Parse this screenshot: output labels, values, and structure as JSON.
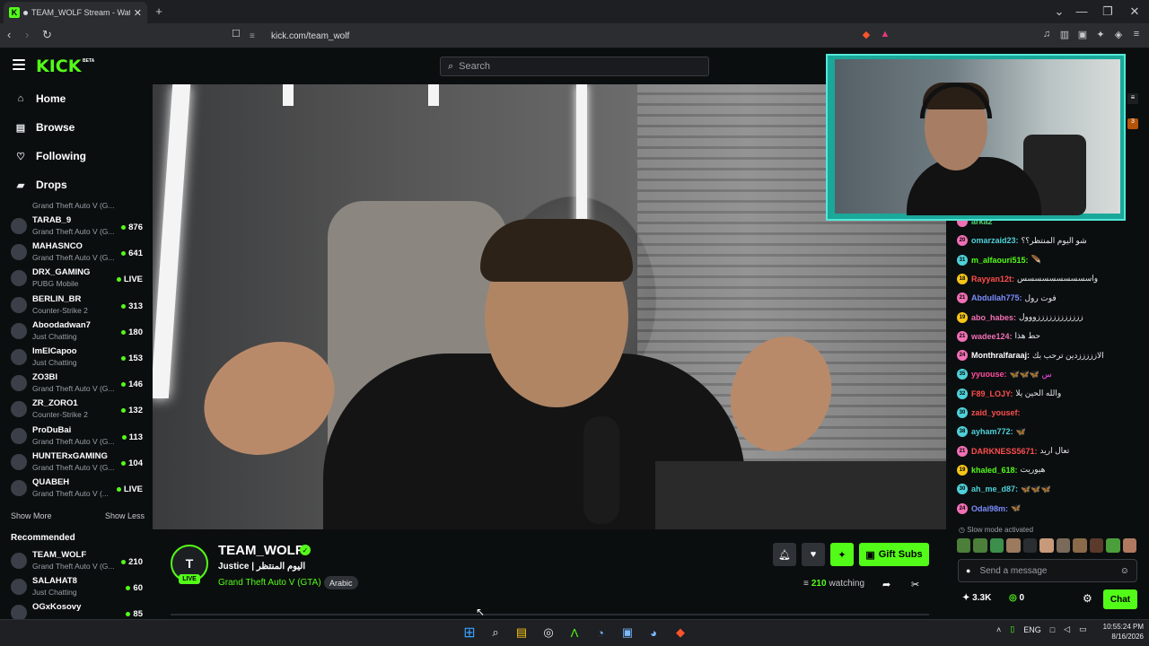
{
  "browser": {
    "tab_title": "TEAM_WOLF Stream - Watch",
    "tab_close": "✕",
    "new_tab": "+",
    "url": "kick.com/team_wolf",
    "window_controls": [
      "⌄",
      "—",
      "❐",
      "✕"
    ]
  },
  "header": {
    "logo": "KICK",
    "beta": "BETA",
    "search_placeholder": "Search"
  },
  "sidebar": {
    "nav": [
      {
        "label": "Home",
        "icon": "home-icon"
      },
      {
        "label": "Browse",
        "icon": "browse-icon"
      },
      {
        "label": "Following",
        "icon": "heart-icon"
      },
      {
        "label": "Drops",
        "icon": "drops-icon"
      }
    ],
    "partial_top_game": "Grand Theft Auto V (G...",
    "following": [
      {
        "name": "TARAB_9",
        "game": "Grand Theft Auto V (G...",
        "viewers": "876"
      },
      {
        "name": "MAHASNCO",
        "game": "Grand Theft Auto V (G...",
        "viewers": "641"
      },
      {
        "name": "DRX_GAMING",
        "game": "PUBG Mobile",
        "viewers": "LIVE"
      },
      {
        "name": "BERLIN_BR",
        "game": "Counter-Strike 2",
        "viewers": "313"
      },
      {
        "name": "Aboodadwan7",
        "game": "Just Chatting",
        "viewers": "180"
      },
      {
        "name": "ImElCapoo",
        "game": "Just Chatting",
        "viewers": "153"
      },
      {
        "name": "ZO3BI",
        "game": "Grand Theft Auto V (G...",
        "viewers": "146"
      },
      {
        "name": "ZR_ZORO1",
        "game": "Counter-Strike 2",
        "viewers": "132"
      },
      {
        "name": "ProDuBai",
        "game": "Grand Theft Auto V (G...",
        "viewers": "113"
      },
      {
        "name": "HUNTERxGAMING",
        "game": "Grand Theft Auto V (G...",
        "viewers": "104"
      },
      {
        "name": "QUABEH",
        "game": "Grand Theft Auto V (...",
        "viewers": "LIVE"
      }
    ],
    "show_more": "Show More",
    "show_less": "Show Less",
    "recommended_label": "Recommended",
    "recommended": [
      {
        "name": "TEAM_WOLF",
        "game": "Grand Theft Auto V (G...",
        "viewers": "210"
      },
      {
        "name": "SALAHAT8",
        "game": "Just Chatting",
        "viewers": "60"
      },
      {
        "name": "OGxKosovy",
        "game": "",
        "viewers": "85"
      }
    ]
  },
  "stream": {
    "avatar_letter": "T",
    "live_label": "LIVE",
    "channel_name": "TEAM_WOLF",
    "title": "Justice | اليوم المنتظر",
    "category": "Grand Theft Auto V (GTA)",
    "language_tag": "Arabic",
    "gift_subs_label": "Gift Subs",
    "viewers": "210",
    "watching_label": "watching"
  },
  "chat": {
    "messages": [
      {
        "badge": "",
        "badge_color": "#f26fb5",
        "user": "arka2",
        "user_color": "#4bd06b",
        "text": ""
      },
      {
        "badge": "20",
        "badge_color": "#f26fb5",
        "user": "omarzaid23:",
        "user_color": "#4fd1d9",
        "text": "شو اليوم المنتظر؟؟"
      },
      {
        "badge": "31",
        "badge_color": "#4fd1d9",
        "user": "m_alfaouri515:",
        "user_color": "#53fc18",
        "text": "🪶"
      },
      {
        "badge": "18",
        "badge_color": "#f5c518",
        "user": "Rayyan12t:",
        "user_color": "#ff4d4d",
        "text": "واسسسسسسسسسس"
      },
      {
        "badge": "21",
        "badge_color": "#f26fb5",
        "user": "Abdullah775:",
        "user_color": "#7b8cff",
        "text": "فوت رول"
      },
      {
        "badge": "19",
        "badge_color": "#f5c518",
        "user": "abo_habes:",
        "user_color": "#f26fb5",
        "text": "ززززززززززززووول"
      },
      {
        "badge": "21",
        "badge_color": "#f26fb5",
        "user": "wadee124:",
        "user_color": "#f26fb5",
        "text": "حط هذا"
      },
      {
        "badge": "24",
        "badge_color": "#f26fb5",
        "user": "Monthralfaraaj:",
        "user_color": "#ffffff",
        "text": "الازززززدين ترحب بك"
      },
      {
        "badge": "35",
        "badge_color": "#4fd1d9",
        "user": "yyuouse:",
        "user_color": "#ff4d9e",
        "text": "🦋🦋🦋 س"
      },
      {
        "badge": "32",
        "badge_color": "#4fd1d9",
        "user": "F89_LOJY:",
        "user_color": "#ff4d4d",
        "text": "والله الحين يلا"
      },
      {
        "badge": "30",
        "badge_color": "#4fd1d9",
        "user": "zaid_yousef:",
        "user_color": "#ff4d4d",
        "text": ""
      },
      {
        "badge": "38",
        "badge_color": "#4fd1d9",
        "user": "ayham772:",
        "user_color": "#4fd1d9",
        "text": "🦋"
      },
      {
        "badge": "21",
        "badge_color": "#f26fb5",
        "user": "DARKNESS5671:",
        "user_color": "#ff4d4d",
        "text": "تعال اريد"
      },
      {
        "badge": "19",
        "badge_color": "#f5c518",
        "user": "khaled_618:",
        "user_color": "#53fc18",
        "text": "هيوريت"
      },
      {
        "badge": "30",
        "badge_color": "#4fd1d9",
        "user": "ah_me_d87:",
        "user_color": "#4fd1d9",
        "text": "🦋🦋🦋"
      },
      {
        "badge": "24",
        "badge_color": "#f26fb5",
        "user": "Odai98m:",
        "user_color": "#7b8cff",
        "text": "🦋"
      }
    ],
    "slow_mode": "Slow mode activated",
    "send_placeholder": "Send a message",
    "points": "3.3K",
    "kicks": "0",
    "chat_button": "Chat"
  },
  "taskbar": {
    "lang": "ENG",
    "time": "10:55:24 PM",
    "date": "8/16/2026"
  },
  "colors": {
    "accent": "#53fc18",
    "background": "#0b0e0f"
  }
}
